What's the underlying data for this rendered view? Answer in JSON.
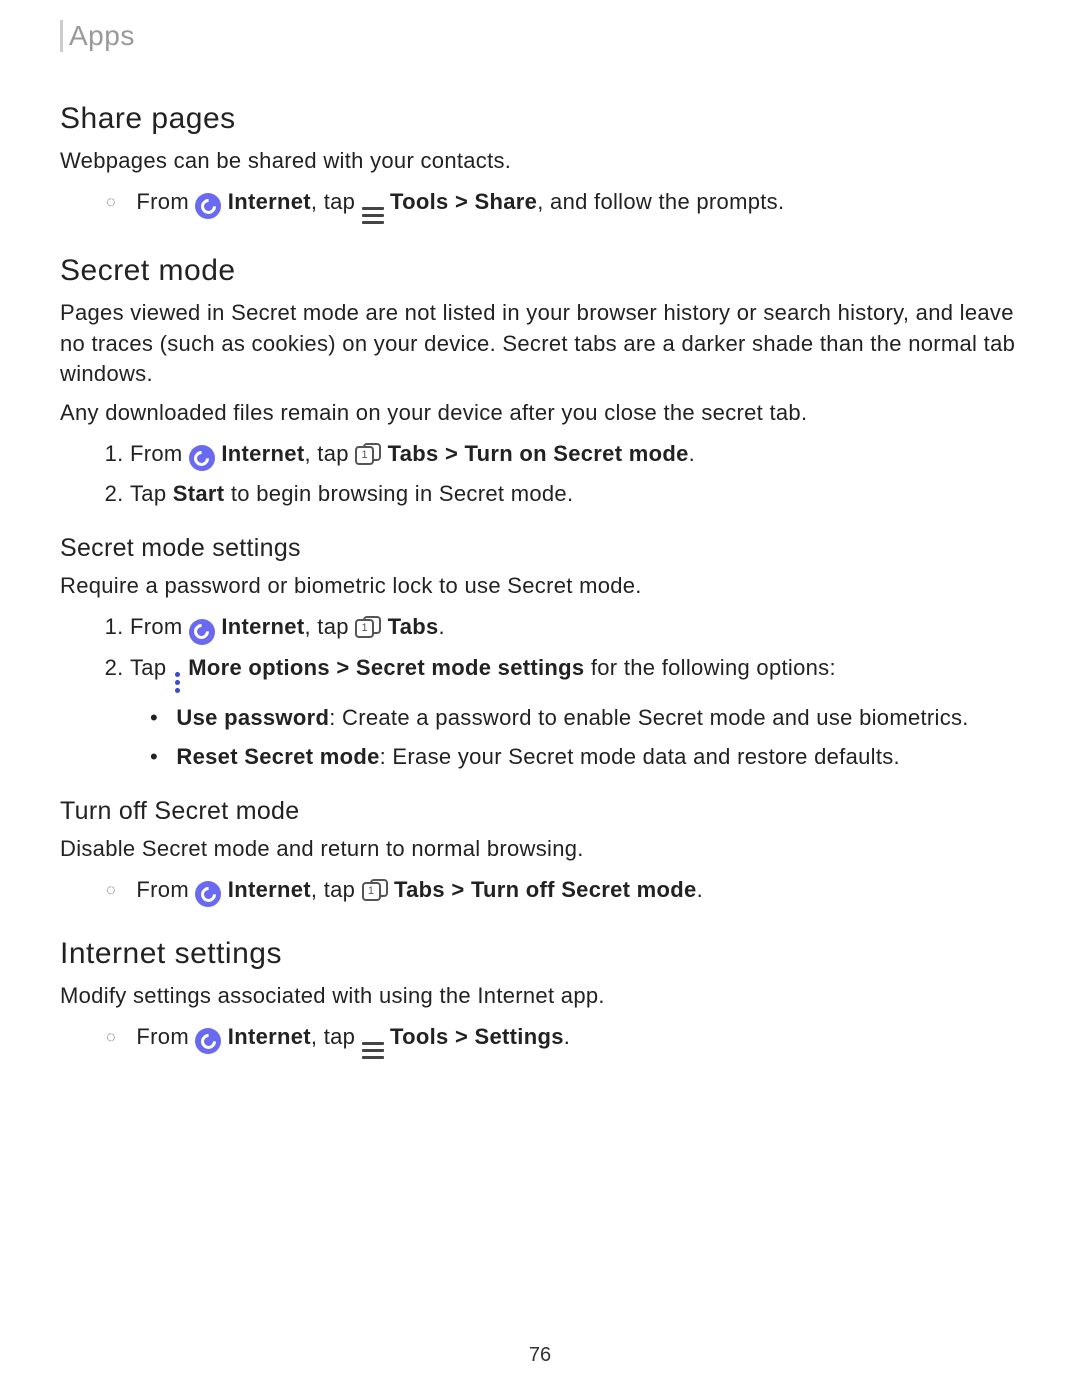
{
  "header": {
    "section": "Apps"
  },
  "share": {
    "title": "Share pages",
    "intro": "Webpages can be shared with your contacts.",
    "step_from": "From ",
    "step_internet": "Internet",
    "step_tap": ", tap ",
    "step_tools": "Tools",
    "step_gt": " > ",
    "step_share": "Share",
    "step_end": ", and follow the prompts."
  },
  "secret": {
    "title": "Secret mode",
    "p1": "Pages viewed in Secret mode are not listed in your browser history or search history, and leave no traces (such as cookies) on your device. Secret tabs are a darker shade than the normal tab windows.",
    "p2": "Any downloaded files remain on your device after you close the secret tab.",
    "step1_from": "From ",
    "step1_internet": "Internet",
    "step1_tap": ", tap ",
    "step1_tabs": "Tabs",
    "step1_gt": " > ",
    "step1_action": "Turn on Secret mode",
    "step1_period": ".",
    "step2_a": "Tap ",
    "step2_b": "Start",
    "step2_c": " to begin browsing in Secret mode."
  },
  "settings": {
    "title": "Secret mode settings",
    "intro": "Require a password or biometric lock to use Secret mode.",
    "step1_from": "From ",
    "step1_internet": "Internet",
    "step1_tap": ", tap ",
    "step1_tabs": "Tabs",
    "step1_period": ".",
    "step2_a": "Tap ",
    "step2_more": "More options",
    "step2_gt": " > ",
    "step2_sms": "Secret mode settings",
    "step2_b": " for the following options:",
    "opt1_t": "Use password",
    "opt1_d": ": Create a password to enable Secret mode and use biometrics.",
    "opt2_t": "Reset Secret mode",
    "opt2_d": ": Erase your Secret mode data and restore defaults."
  },
  "turnoff": {
    "title": "Turn off Secret mode",
    "intro": "Disable Secret mode and return to normal browsing.",
    "step_from": "From ",
    "step_internet": "Internet",
    "step_tap": ", tap ",
    "step_tabs": "Tabs",
    "step_gt": " > ",
    "step_action": "Turn off Secret mode",
    "step_period": "."
  },
  "isettings": {
    "title": "Internet settings",
    "intro": "Modify settings associated with using the Internet app.",
    "step_from": "From ",
    "step_internet": "Internet",
    "step_tap": ", tap ",
    "step_tools": "Tools",
    "step_gt": " > ",
    "step_settings": "Settings",
    "step_period": "."
  },
  "page_number": "76"
}
